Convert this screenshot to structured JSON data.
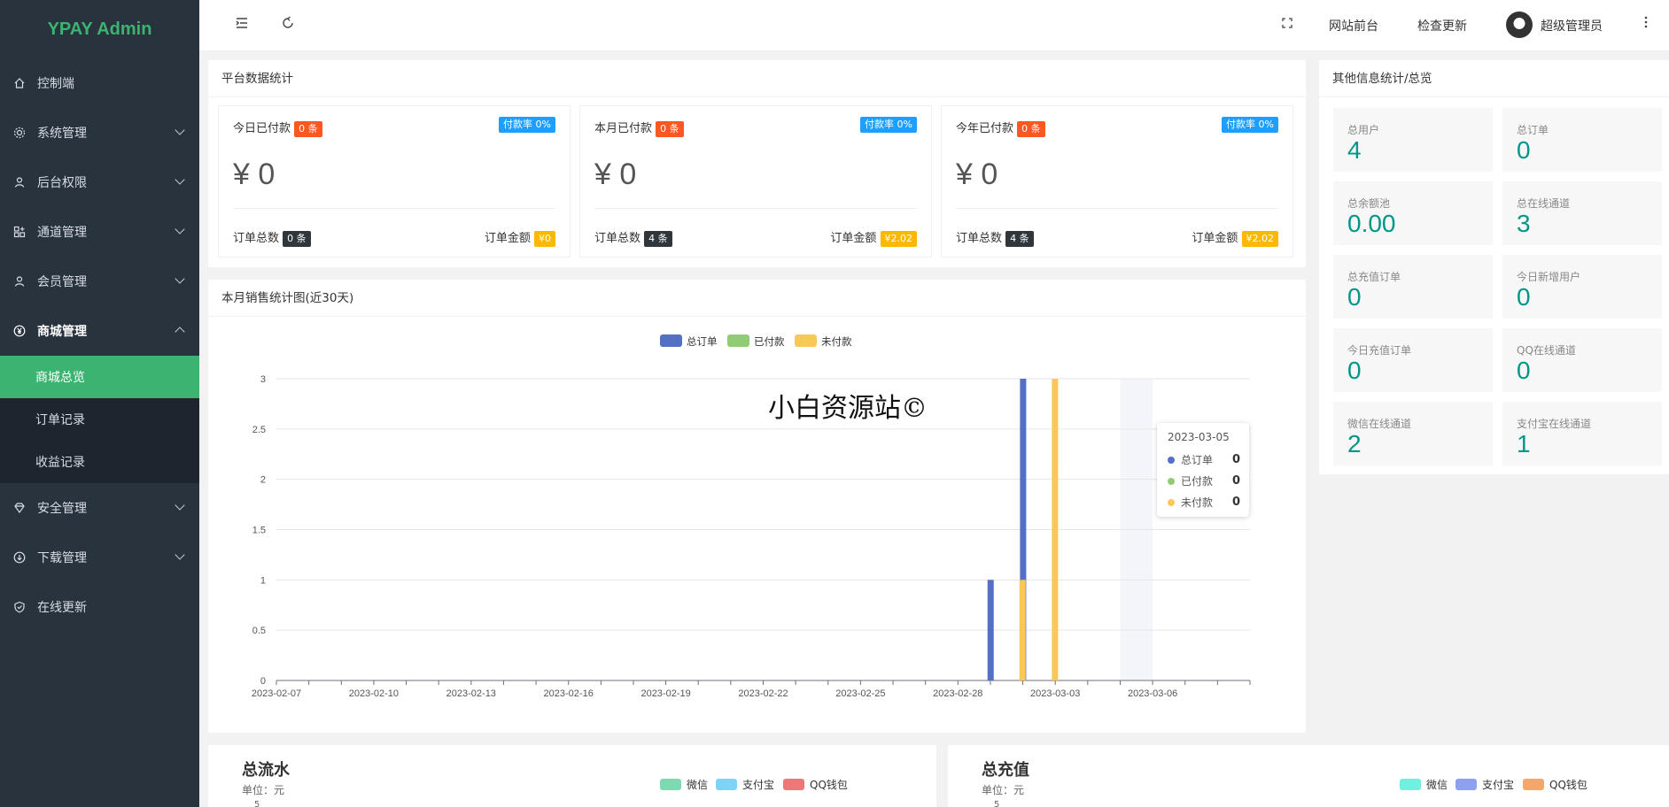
{
  "app": {
    "title": "YPAY Admin"
  },
  "sidebar": {
    "items": [
      {
        "label": "控制端"
      },
      {
        "label": "系统管理"
      },
      {
        "label": "后台权限"
      },
      {
        "label": "通道管理"
      },
      {
        "label": "会员管理"
      },
      {
        "label": "商城管理"
      }
    ],
    "sub_items": [
      {
        "label": "商城总览"
      },
      {
        "label": "订单记录"
      },
      {
        "label": "收益记录"
      }
    ],
    "items_after": [
      {
        "label": "安全管理"
      },
      {
        "label": "下载管理"
      },
      {
        "label": "在线更新"
      }
    ]
  },
  "topbar": {
    "frontend": "网站前台",
    "check_update": "检查更新",
    "username": "超级管理员"
  },
  "platform": {
    "title": "平台数据统计",
    "cards": [
      {
        "title": "今日已付款",
        "count": "0 条",
        "rate": "付款率 0%",
        "amount": "¥ 0",
        "order_label": "订单总数",
        "order_count": "0 条",
        "money_label": "订单金额",
        "money": "¥0"
      },
      {
        "title": "本月已付款",
        "count": "0 条",
        "rate": "付款率 0%",
        "amount": "¥ 0",
        "order_label": "订单总数",
        "order_count": "4 条",
        "money_label": "订单金额",
        "money": "¥2.02"
      },
      {
        "title": "今年已付款",
        "count": "0 条",
        "rate": "付款率 0%",
        "amount": "¥ 0",
        "order_label": "订单总数",
        "order_count": "4 条",
        "money_label": "订单金额",
        "money": "¥2.02"
      }
    ]
  },
  "other": {
    "title": "其他信息统计/总览",
    "boxes": [
      {
        "label": "总用户",
        "value": "4"
      },
      {
        "label": "总订单",
        "value": "0"
      },
      {
        "label": "总余额池",
        "value": "0.00"
      },
      {
        "label": "总在线通道",
        "value": "3"
      },
      {
        "label": "总充值订单",
        "value": "0"
      },
      {
        "label": "今日新增用户",
        "value": "0"
      },
      {
        "label": "今日充值订单",
        "value": "0"
      },
      {
        "label": "QQ在线通道",
        "value": "0"
      },
      {
        "label": "微信在线通道",
        "value": "2"
      },
      {
        "label": "支付宝在线通道",
        "value": "1"
      }
    ]
  },
  "sales": {
    "title": "本月销售统计图(近30天)",
    "watermark": "小白资源站©",
    "tooltip": {
      "date": "2023-03-05",
      "rows": [
        {
          "name": "总订单",
          "value": "0",
          "color": "#5470c6"
        },
        {
          "name": "已付款",
          "value": "0",
          "color": "#91cc75"
        },
        {
          "name": "未付款",
          "value": "0",
          "color": "#fac858"
        }
      ]
    }
  },
  "chart_data": {
    "type": "bar",
    "x_tick_labels": [
      "2023-02-07",
      "2023-02-10",
      "2023-02-13",
      "2023-02-16",
      "2023-02-19",
      "2023-02-22",
      "2023-02-25",
      "2023-02-28",
      "2023-03-03",
      "2023-03-06"
    ],
    "y_ticks": [
      "0",
      "0.5",
      "1",
      "1.5",
      "2",
      "2.5",
      "3"
    ],
    "ylim": [
      0,
      3
    ],
    "categories": [
      "2023-02-07",
      "2023-02-08",
      "2023-02-09",
      "2023-02-10",
      "2023-02-11",
      "2023-02-12",
      "2023-02-13",
      "2023-02-14",
      "2023-02-15",
      "2023-02-16",
      "2023-02-17",
      "2023-02-18",
      "2023-02-19",
      "2023-02-20",
      "2023-02-21",
      "2023-02-22",
      "2023-02-23",
      "2023-02-24",
      "2023-02-25",
      "2023-02-26",
      "2023-02-27",
      "2023-02-28",
      "2023-03-01",
      "2023-03-02",
      "2023-03-03",
      "2023-03-04",
      "2023-03-05",
      "2023-03-06",
      "2023-03-07",
      "2023-03-08"
    ],
    "series": [
      {
        "name": "总订单",
        "color": "#5470c6",
        "values": [
          0,
          0,
          0,
          0,
          0,
          0,
          0,
          0,
          0,
          0,
          0,
          0,
          0,
          0,
          0,
          0,
          0,
          0,
          0,
          0,
          0,
          0,
          1,
          3,
          0,
          0,
          0,
          0,
          0,
          0
        ]
      },
      {
        "name": "已付款",
        "color": "#91cc75",
        "values": [
          0,
          0,
          0,
          0,
          0,
          0,
          0,
          0,
          0,
          0,
          0,
          0,
          0,
          0,
          0,
          0,
          0,
          0,
          0,
          0,
          0,
          0,
          0,
          0,
          0,
          0,
          0,
          0,
          0,
          0
        ]
      },
      {
        "name": "未付款",
        "color": "#fac858",
        "values": [
          0,
          0,
          0,
          0,
          0,
          0,
          0,
          0,
          0,
          0,
          0,
          0,
          0,
          0,
          0,
          0,
          0,
          0,
          0,
          0,
          0,
          0,
          1,
          3,
          0,
          0,
          0,
          0,
          0,
          0
        ]
      }
    ],
    "highlight_category": "2023-03-05",
    "legend": "top-center"
  },
  "bottom": {
    "left": {
      "title": "总流水",
      "unit": "单位：元",
      "tick": "5",
      "legend": [
        {
          "name": "微信",
          "color": "#7dd9b0"
        },
        {
          "name": "支付宝",
          "color": "#7fd3f5"
        },
        {
          "name": "QQ钱包",
          "color": "#ee7777"
        }
      ]
    },
    "right": {
      "title": "总充值",
      "unit": "单位：元",
      "tick": "5",
      "legend": [
        {
          "name": "微信",
          "color": "#6ff0e0"
        },
        {
          "name": "支付宝",
          "color": "#8ea0f0"
        },
        {
          "name": "QQ钱包",
          "color": "#f5a66a"
        }
      ]
    }
  }
}
